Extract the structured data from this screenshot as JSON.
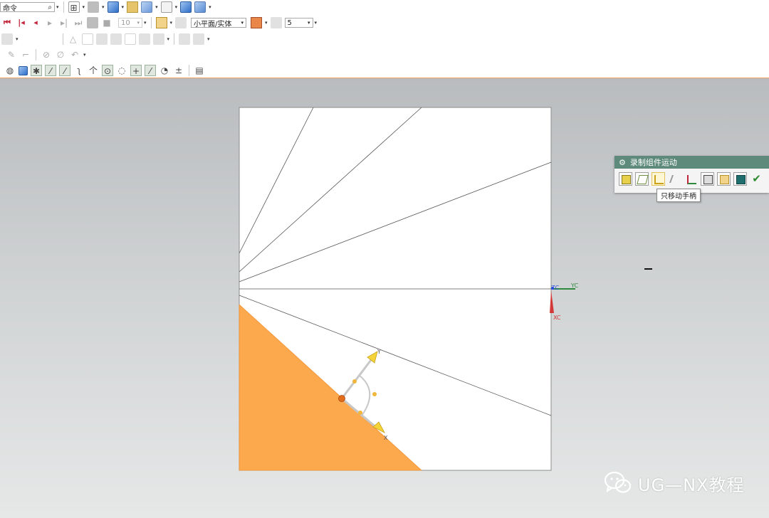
{
  "toolbar": {
    "search_value": "命令",
    "frame_count": "10",
    "display_mode": "小平面/实体",
    "step_value": "5"
  },
  "dialog": {
    "title": "录制组件运动",
    "tooltip": "只移动手柄"
  },
  "axes": {
    "zc": "ZC",
    "yc": "YC",
    "xc": "XC"
  },
  "handle": {
    "y_label": "Y",
    "x_label": "X"
  },
  "watermark": {
    "text": "UG—NX教程"
  },
  "colors": {
    "model_fill": "#fca84c",
    "dialog_title_bar": "#5d8a7b",
    "accent_orange_border": "#f0a060",
    "zc_axis": "#2b4ee0",
    "yc_axis": "#2f8a3e",
    "xc_axis": "#d23a3a"
  },
  "icons": {
    "search": "search-icon",
    "confirm": "checkmark-icon",
    "settings": "gear-icon"
  }
}
